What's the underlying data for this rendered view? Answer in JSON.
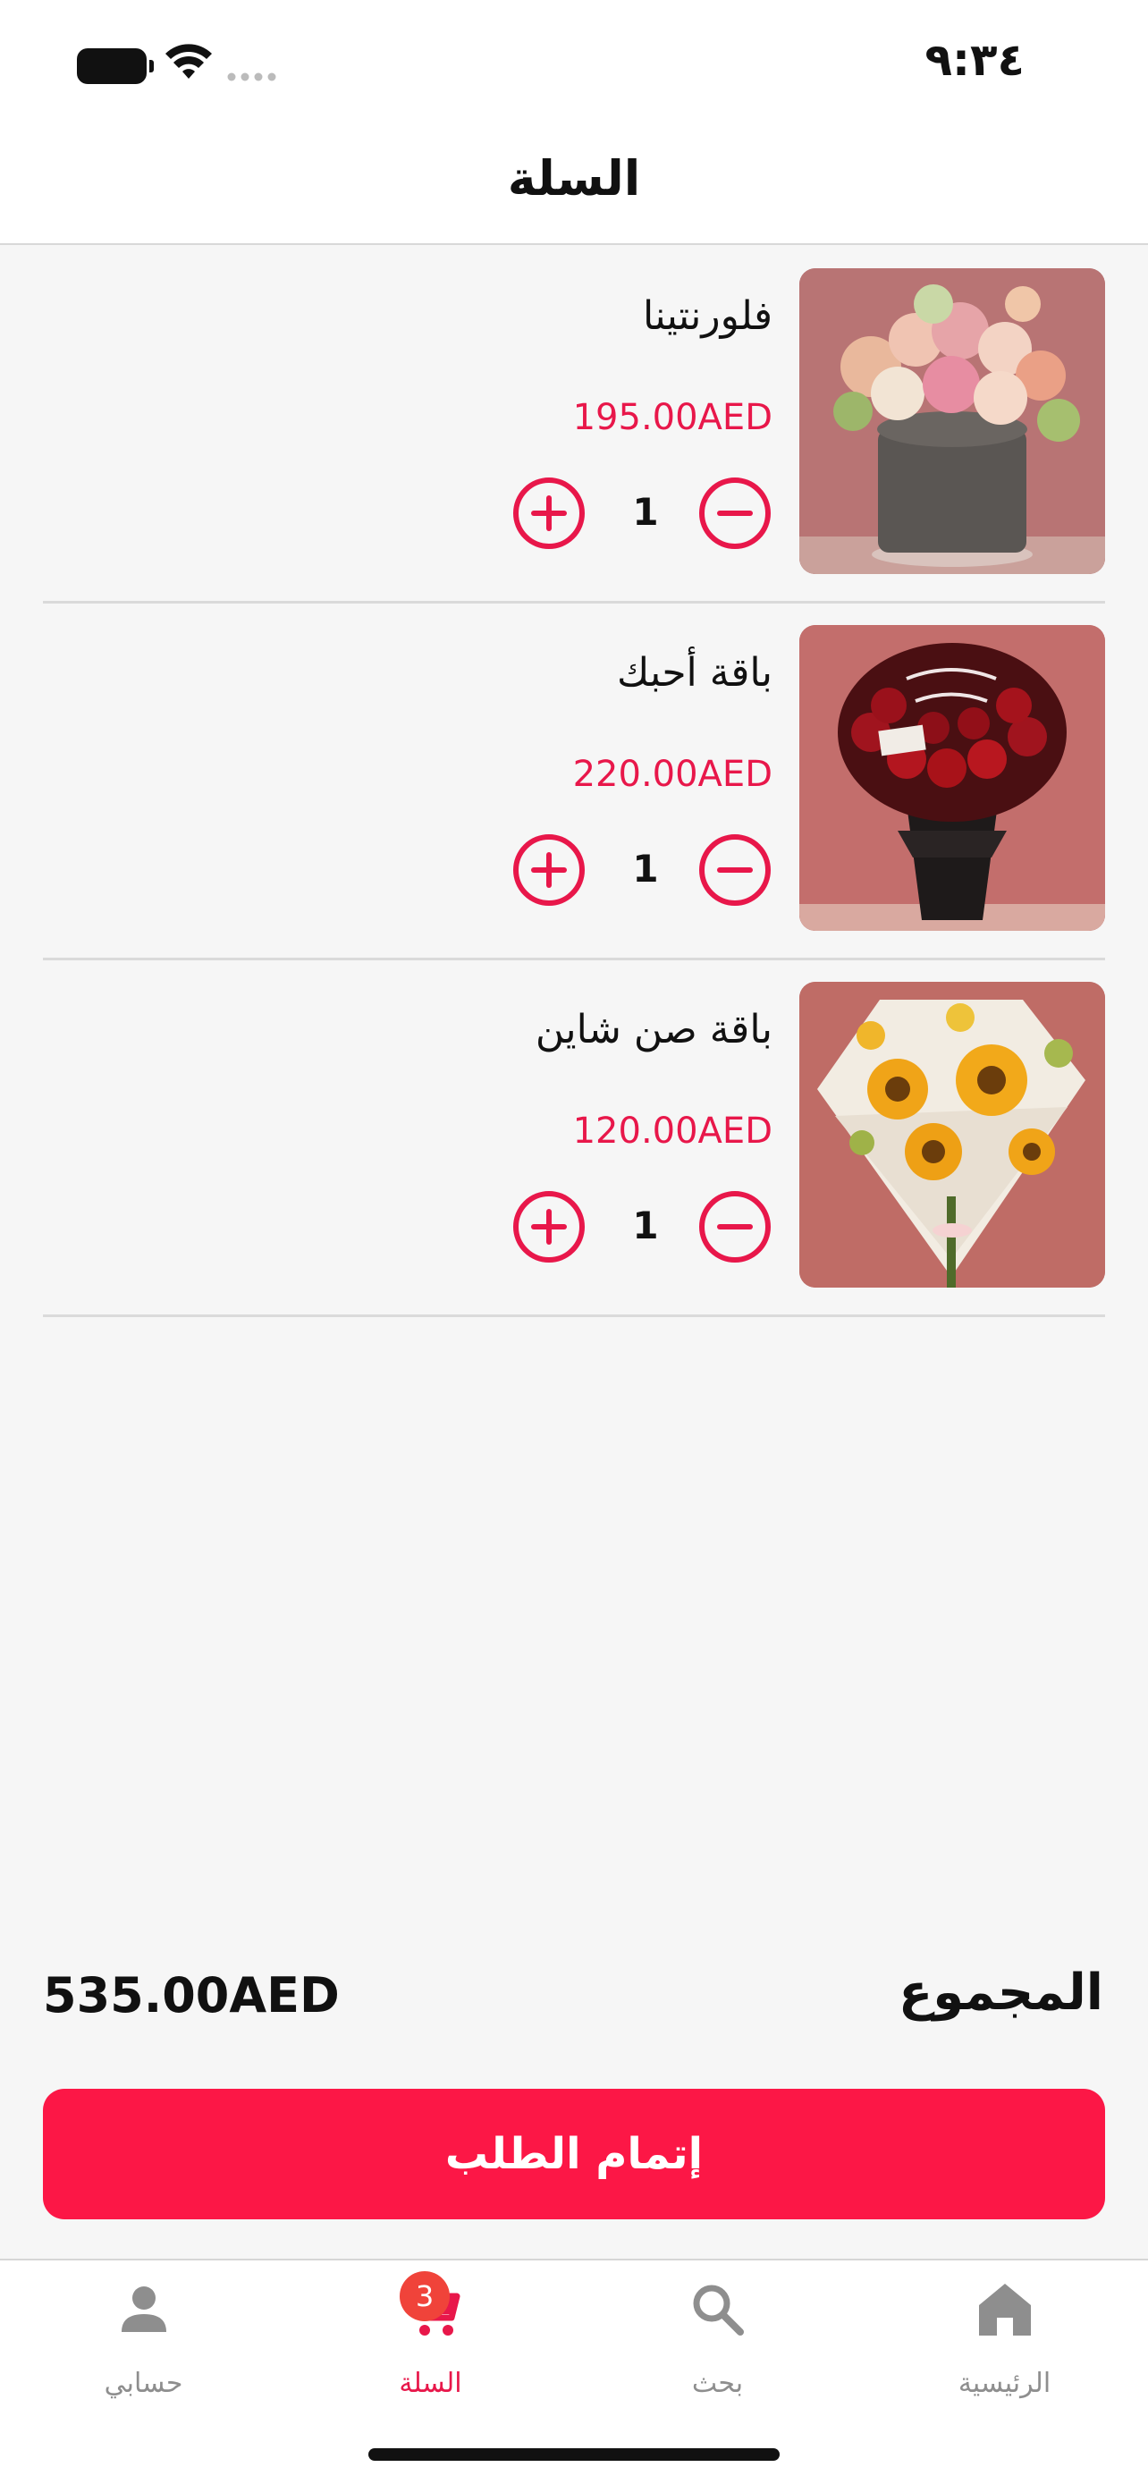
{
  "status_bar": {
    "time": "٩:٣٤"
  },
  "header": {
    "title": "السلة"
  },
  "cart": {
    "items": [
      {
        "name": "فلورنتينا",
        "price": "195.00AED",
        "quantity": "1",
        "image": "flower-box-pastel"
      },
      {
        "name": "باقة أحبك",
        "price": "220.00AED",
        "quantity": "1",
        "image": "red-roses-bouquet"
      },
      {
        "name": "باقة صن شاين",
        "price": "120.00AED",
        "quantity": "1",
        "image": "sunflower-bouquet"
      }
    ]
  },
  "totals": {
    "label": "المجموع",
    "value": "535.00AED"
  },
  "checkout": {
    "label": "إتمام الطلب"
  },
  "tab_bar": {
    "tabs": [
      {
        "label": "حسابي",
        "icon": "person-icon"
      },
      {
        "label": "السلة",
        "icon": "cart-icon",
        "badge": "3",
        "active": true
      },
      {
        "label": "بحث",
        "icon": "search-icon"
      },
      {
        "label": "الرئيسية",
        "icon": "home-icon"
      }
    ]
  },
  "colors": {
    "accent": "#fc1746",
    "price": "#e8174a",
    "inactive": "#8e8e8e"
  }
}
